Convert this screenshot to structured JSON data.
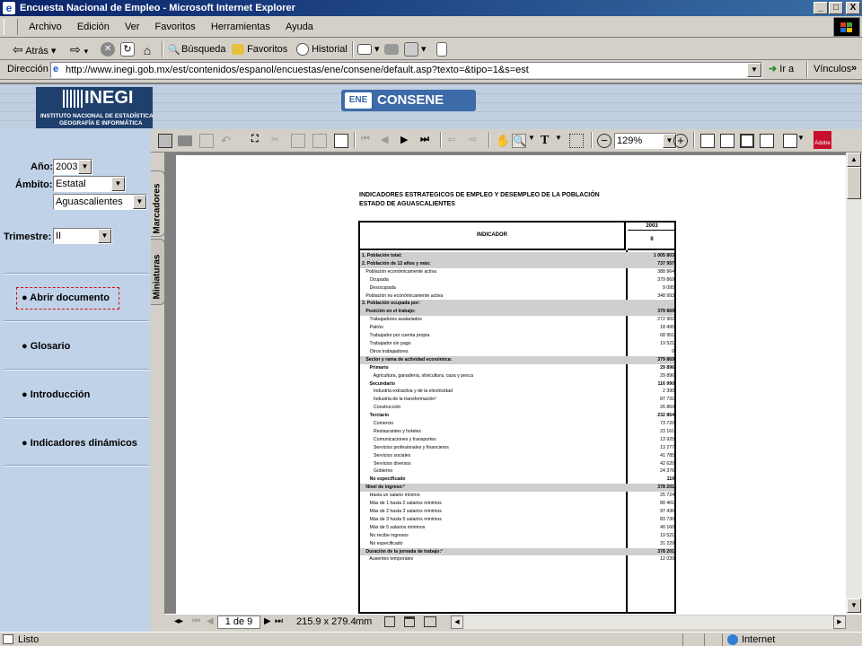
{
  "window": {
    "title": "Encuesta Nacional de Empleo - Microsoft Internet Explorer",
    "min": "_",
    "max": "□",
    "close": "X"
  },
  "menu": [
    "Archivo",
    "Edición",
    "Ver",
    "Favoritos",
    "Herramientas",
    "Ayuda"
  ],
  "toolbar": {
    "back": "Atrás",
    "search": "Búsqueda",
    "favorites": "Favoritos",
    "history": "Historial"
  },
  "address": {
    "label": "Dirección",
    "url": "http://www.inegi.gob.mx/est/contenidos/espanol/encuestas/ene/consene/default.asp?texto=&tipo=1&s=est",
    "go": "Ir a",
    "links": "Vínculos"
  },
  "banner": {
    "logo": "INEGI",
    "subtitle1": "INSTITUTO NACIONAL DE ESTADÍSTICA",
    "subtitle2": "GEOGRAFÍA E INFORMÁTICA",
    "app": "CONSENE",
    "app_mark": "ENE"
  },
  "filters": {
    "year_label": "Año:",
    "year_value": "2003",
    "scope_label": "Ámbito:",
    "scope_value": "Estatal",
    "state_value": "Aguascalientes",
    "quarter_label": "Trimestre:",
    "quarter_value": "II"
  },
  "nav": {
    "open_doc": "Abrir documento",
    "glossary": "Glosario",
    "intro": "Introducción",
    "dynamic": "Indicadores dinámicos"
  },
  "side_tabs": {
    "bookmarks": "Marcadores",
    "thumbnails": "Miniaturas"
  },
  "acrobat": {
    "zoom": "129%",
    "page_indicator": "1 de 9",
    "page_size": "215.9 x 279.4",
    "unit": "mm"
  },
  "doc": {
    "title1": "INDICADORES ESTRATEGICOS DE EMPLEO Y DESEMPLEO DE LA POBLACIÓN",
    "title2": "ESTADO DE AGUASCALIENTES",
    "col_header": "INDICADOR",
    "year": "2003",
    "quarter": "II",
    "rows": [
      [
        "",
        "",
        " "
      ],
      [
        "1. Población total:",
        "1 005 803",
        "g"
      ],
      [
        "",
        "",
        " "
      ],
      [
        "2. Población de 12 años y más:",
        "737 957",
        "g"
      ],
      [
        "   Población económicamente activa",
        "388 964",
        ""
      ],
      [
        "      Ocupada",
        "379 869",
        ""
      ],
      [
        "      Desocupada",
        "9 095",
        ""
      ],
      [
        "   Población no económicamente activa",
        "348 993",
        ""
      ],
      [
        "",
        "",
        " "
      ],
      [
        "3. Población ocupada por:",
        "",
        "g"
      ],
      [
        "",
        "",
        " "
      ],
      [
        "   Posición en el trabajo:",
        "379 869",
        "g"
      ],
      [
        "      Trabajadores asalariados",
        "272 902",
        ""
      ],
      [
        "      Patrón",
        "18 495",
        ""
      ],
      [
        "      Trabajador por cuenta propia",
        "68 951",
        ""
      ],
      [
        "      Trabajador sin pago",
        "19 521",
        ""
      ],
      [
        "      Otros trabajadores",
        "0",
        ""
      ],
      [
        "",
        "",
        " "
      ],
      [
        "   Sector y rama de actividad económica:",
        "379 869",
        "g"
      ],
      [
        "      Primario",
        "29 896",
        "b"
      ],
      [
        "         Agricultura, ganadería, silvicultura, caza y pesca",
        "29 896",
        ""
      ],
      [
        "      Secundario",
        "116 990",
        "b"
      ],
      [
        "         Industria extractiva y de la electricidad",
        "2 390",
        ""
      ],
      [
        "         Industria de la transformación¹",
        "87 731",
        ""
      ],
      [
        "         Construcción",
        "26 869",
        ""
      ],
      [
        "      Terciario",
        "232 864",
        "b"
      ],
      [
        "         Comercio",
        "73 720",
        ""
      ],
      [
        "         Restaurantes y hoteles",
        "23 161",
        ""
      ],
      [
        "         Comunicaciones y transportes",
        "13 925",
        ""
      ],
      [
        "         Servicios profesionales y financieros",
        "13 277",
        ""
      ],
      [
        "         Servicios sociales",
        "41 785",
        ""
      ],
      [
        "         Servicios diversos",
        "42 620",
        ""
      ],
      [
        "         Gobierno",
        "24 376",
        ""
      ],
      [
        "      No especificado",
        "119",
        "b"
      ],
      [
        "",
        "",
        " "
      ],
      [
        "   Nivel de ingreso:²",
        "378 201",
        "g"
      ],
      [
        "      Hasta un salario mínimo",
        "25 724",
        ""
      ],
      [
        "      Más de 1 hasta 2 salarios mínimos",
        "80 401",
        ""
      ],
      [
        "      Más de 2 hasta 3 salarios mínimos",
        "97 436",
        ""
      ],
      [
        "      Más de 3 hasta 5 salarios mínimos",
        "83 730",
        ""
      ],
      [
        "      Más de 5 salarios mínimos",
        "40 160",
        ""
      ],
      [
        "      No recibe ingresos",
        "19 521",
        ""
      ],
      [
        "      No especificado",
        "31 229",
        ""
      ],
      [
        "",
        "",
        " "
      ],
      [
        "   Duración de la jornada de trabajo:²",
        "378 201",
        "g"
      ],
      [
        "      Ausentes temporales",
        "12 039",
        ""
      ]
    ]
  },
  "status": {
    "left": "Listo",
    "zone": "Internet"
  }
}
